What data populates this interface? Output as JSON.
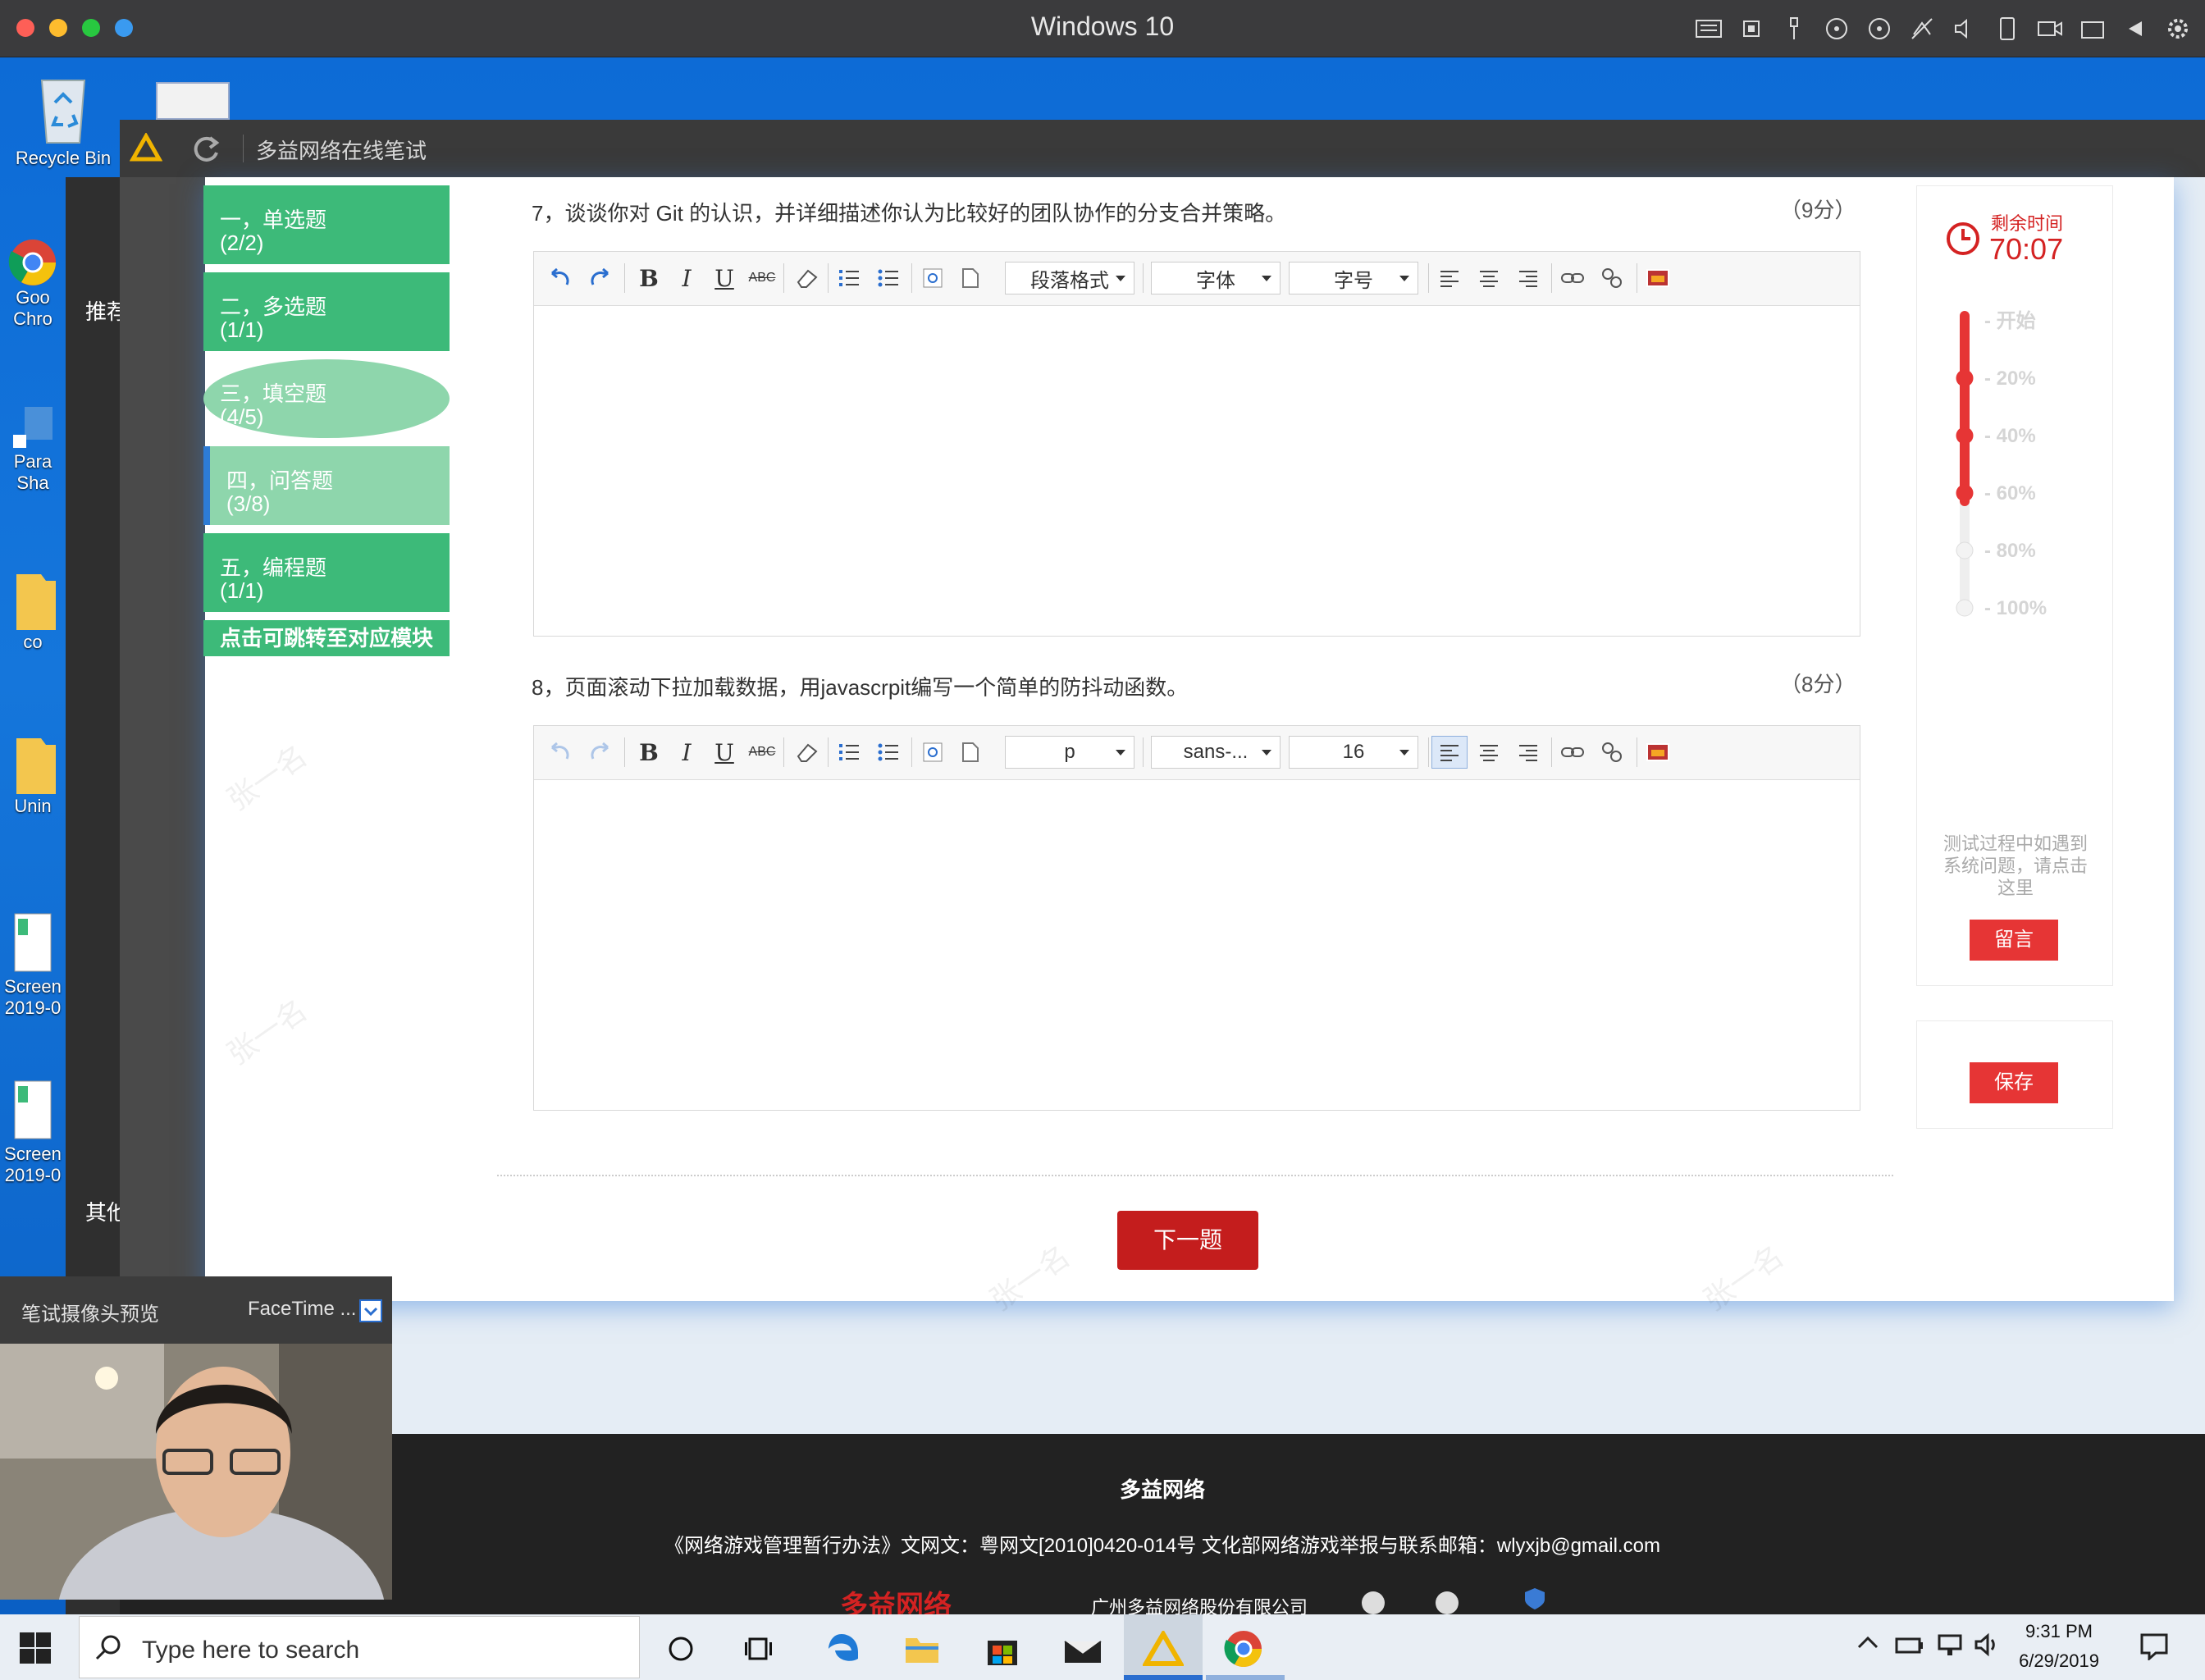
{
  "mac": {
    "title": "Windows 10"
  },
  "desktop": {
    "icons": [
      {
        "label": "Recycle Bin"
      },
      {
        "label": "Goo"
      },
      {
        "label": "Chro"
      },
      {
        "label": "Para"
      },
      {
        "label": "Sha"
      },
      {
        "label": "co"
      },
      {
        "label": "Unin"
      },
      {
        "label": "Screen"
      },
      {
        "label": "2019-0"
      },
      {
        "label": "Screen"
      },
      {
        "label": "2019-0"
      }
    ],
    "side_labels": [
      "推荐",
      "其他"
    ]
  },
  "app": {
    "title": "多益网络在线笔试"
  },
  "nav": {
    "items": [
      {
        "title": "一，单选题",
        "count": "(2/2)"
      },
      {
        "title": "二，多选题",
        "count": "(1/1)"
      },
      {
        "title": "三，填空题",
        "count": "(4/5)"
      },
      {
        "title": "四，问答题",
        "count": "(3/8)"
      },
      {
        "title": "五，编程题",
        "count": "(1/1)"
      }
    ],
    "hint": "点击可跳转至对应模块"
  },
  "questions": [
    {
      "title": "7，谈谈你对 Git 的认识，并详细描述你认为比较好的团队协作的分支合并策略。",
      "score": "（9分）",
      "toolbar": {
        "paragraph": "段落格式",
        "font": "字体",
        "size": "字号"
      }
    },
    {
      "title": "8，页面滚动下拉加载数据，用javascrpit编写一个简单的防抖动函数。",
      "score": "（8分）",
      "toolbar": {
        "paragraph": "p",
        "font": "sans-...",
        "size": "16"
      }
    }
  ],
  "next_button": "下一题",
  "timer": {
    "label": "剩余时间",
    "value": "70:07",
    "progress_fraction": 0.68,
    "marks": [
      "- 开始",
      "- 20%",
      "- 40%",
      "- 60%",
      "- 80%",
      "- 100%"
    ]
  },
  "help": {
    "text": "测试过程中如遇到系统问题，请点击这里",
    "button": "留言"
  },
  "save_button": "保存",
  "footer": {
    "brand": "多益网络",
    "license": "《网络游戏管理暂行办法》文网文：粤网文[2010]0420-014号 文化部网络游戏举报与联系邮箱：wlyxjb@gmail.com",
    "logo_text": "多益网络",
    "company": "广州多益网络股份有限公司"
  },
  "camera": {
    "title": "笔试摄像头预览",
    "device": "FaceTime ..."
  },
  "taskbar": {
    "search_placeholder": "Type here to search",
    "time": "9:31 PM",
    "date": "6/29/2019"
  },
  "watermark": "张一名",
  "colors": {
    "accent_green": "#3dba79",
    "accent_red": "#e63535",
    "timer_red": "#d42222"
  }
}
